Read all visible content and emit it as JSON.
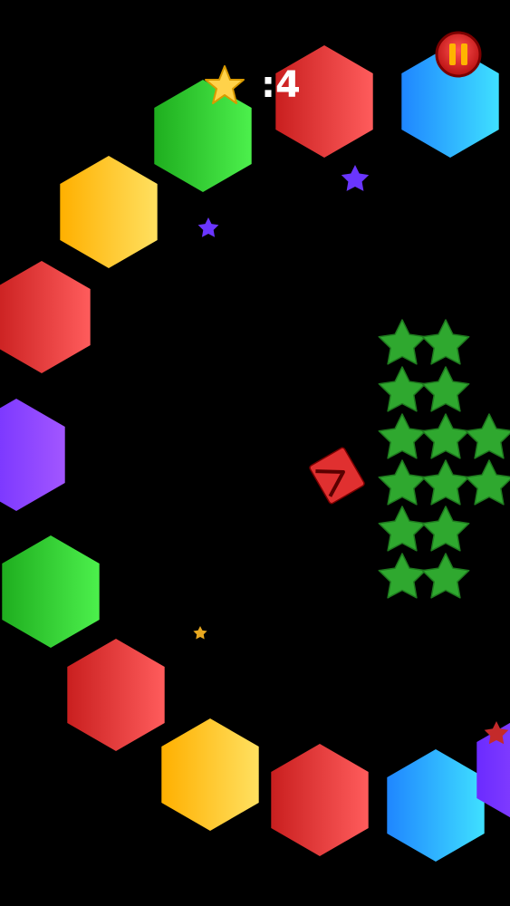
{
  "hud": {
    "score_text": ":4",
    "score_value": 4,
    "score_icon": "star-icon",
    "pause_icon": "pause-icon"
  },
  "colors": {
    "background": "#000000",
    "red": "#e63a3a",
    "green": "#34d634",
    "yellow": "#ffc72a",
    "blue": "#2fa8ff",
    "purple": "#8a44ff",
    "star_green": "#2fa82f",
    "pause_red": "#d71f1f",
    "pause_bars": "#ffb400",
    "player_red": "#e03030"
  },
  "hex_ring": [
    "green",
    "red",
    "blue",
    "yellow",
    "red",
    "purple",
    "green",
    "red",
    "yellow",
    "red",
    "blue",
    "purple"
  ],
  "green_star_rows": [
    2,
    2,
    3,
    3,
    2,
    2
  ],
  "floating_stars": [
    "purple",
    "purple",
    "yellow",
    "red"
  ]
}
